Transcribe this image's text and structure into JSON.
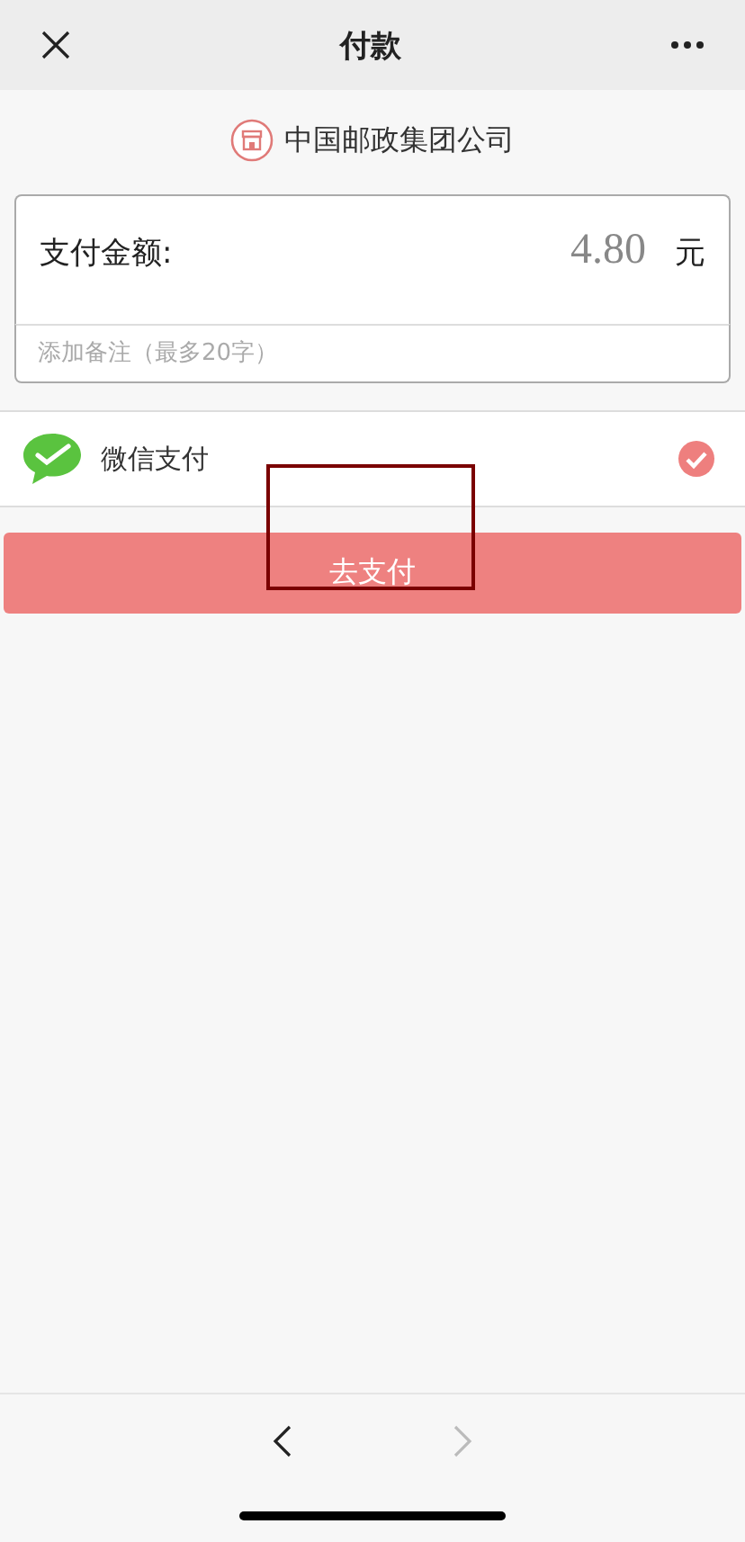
{
  "header": {
    "title": "付款"
  },
  "merchant": {
    "name": "中国邮政集团公司"
  },
  "amount": {
    "label": "支付金额:",
    "value": "4.80",
    "unit": "元"
  },
  "remark": {
    "placeholder": "添加备注（最多20字）"
  },
  "payment_method": {
    "label": "微信支付",
    "selected": true
  },
  "pay_button": {
    "label": "去支付"
  },
  "bottom_nav": {
    "back_disabled": false,
    "forward_disabled": true
  }
}
